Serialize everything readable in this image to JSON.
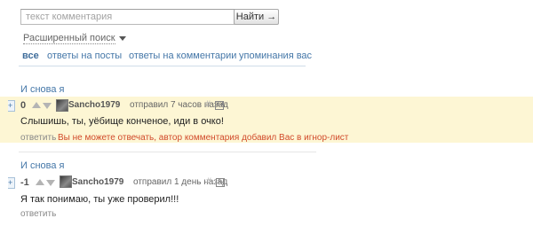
{
  "search": {
    "placeholder": "текст комментария",
    "button_label": "Найти →",
    "advanced_label": "Расширенный поиск"
  },
  "tabs": [
    {
      "label": "все",
      "active": true
    },
    {
      "label": "ответы на посты",
      "active": false
    },
    {
      "label": "ответы на комментарии",
      "active": false
    },
    {
      "label": "упоминания вас",
      "active": false
    }
  ],
  "comments": [
    {
      "post_title": "И снова я",
      "expand_label": "+",
      "rating": "0",
      "author": "Sancho1979",
      "meta": "отправил 7 часов назад",
      "hash": "#",
      "text": "Слышишь, ты, уёбище конченое, иди в очко!",
      "reply_label": "ответить",
      "warning": "Вы не можете отвечать, автор комментария добавил Вас в игнор-лист",
      "highlighted": true
    },
    {
      "post_title": "И снова я",
      "expand_label": "+",
      "rating": "-1",
      "author": "Sancho1979",
      "meta": "отправил 1 день назад",
      "hash": "#",
      "text": "Я так понимаю, ты уже проверил!!!",
      "reply_label": "ответить",
      "warning": "",
      "highlighted": false
    }
  ],
  "colors": {
    "link": "#4577a8",
    "highlight_bg": "#fdf6d4",
    "warning": "#d14a2a"
  },
  "icons": [
    "chevron-down-icon",
    "vote-up-icon",
    "vote-down-icon",
    "avatar",
    "save-icon",
    "expand-icon"
  ]
}
